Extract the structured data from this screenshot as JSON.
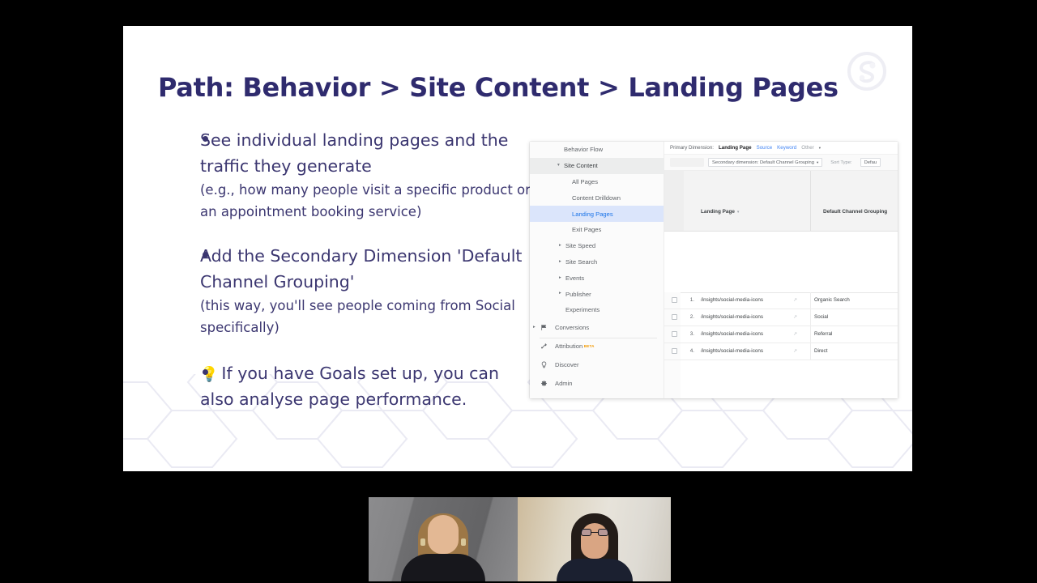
{
  "slide": {
    "title": "Path: Behavior > Site Content > Landing Pages",
    "watermark_icon": "circular-brand-logo",
    "accent_color": "#2f2b6e",
    "body_color": "#3b3670",
    "background": "#ffffff",
    "bullets": [
      {
        "dot": "•",
        "main": "See individual landing pages and the traffic they generate",
        "sub": "(e.g., how many people visit a specific product or an appointment booking service)"
      },
      {
        "dot": "•",
        "main": "Add the Secondary Dimension 'Default Channel Grouping'",
        "sub": "(this way, you'll see people coming from Social specifically)"
      },
      {
        "dot": "•",
        "emoji": "💡",
        "main": "If you have Goals set up, you can also analyse page performance.",
        "sub": ""
      }
    ]
  },
  "ga_screenshot": {
    "nav": [
      {
        "label": "Behavior Flow",
        "level": 2,
        "caret": "",
        "state": "normal"
      },
      {
        "label": "Site Content",
        "level": 2,
        "caret": "▾",
        "state": "header"
      },
      {
        "label": "All Pages",
        "level": 3,
        "caret": "",
        "state": "normal"
      },
      {
        "label": "Content Drilldown",
        "level": 3,
        "caret": "",
        "state": "normal"
      },
      {
        "label": "Landing Pages",
        "level": 3,
        "caret": "",
        "state": "active"
      },
      {
        "label": "Exit Pages",
        "level": 3,
        "caret": "",
        "state": "normal"
      },
      {
        "label": "Site Speed",
        "level": 2,
        "caret": "▸",
        "state": "normal"
      },
      {
        "label": "Site Search",
        "level": 2,
        "caret": "▸",
        "state": "normal"
      },
      {
        "label": "Events",
        "level": 2,
        "caret": "▸",
        "state": "normal"
      },
      {
        "label": "Publisher",
        "level": 2,
        "caret": "▸",
        "state": "normal"
      },
      {
        "label": "Experiments",
        "level": 2,
        "caret": "",
        "state": "normal"
      }
    ],
    "nav_bottom": [
      {
        "label": "Conversions",
        "icon": "flag-icon",
        "caret": "▸",
        "badge": ""
      },
      {
        "label": "Attribution",
        "icon": "attribution-icon",
        "caret": "",
        "badge": "BETA"
      },
      {
        "label": "Discover",
        "icon": "lightbulb-icon",
        "caret": "",
        "badge": ""
      },
      {
        "label": "Admin",
        "icon": "gear-icon",
        "caret": "",
        "badge": ""
      }
    ],
    "toolbar_primary": {
      "label": "Primary Dimension:",
      "selected": "Landing Page",
      "links": [
        "Source",
        "Keyword",
        "Other"
      ],
      "other_caret": "▾"
    },
    "toolbar_secondary": {
      "ghost_button": "",
      "secondary_dimension": "Secondary dimension: Default Channel Grouping",
      "secondary_caret": "▾",
      "sort_type_label": "Sort Type:",
      "sort_type_value": "Defau"
    },
    "table": {
      "columns": [
        "Landing Page",
        "Default Channel Grouping"
      ],
      "sort_caret": "▾",
      "rows": [
        {
          "index": "1.",
          "landing_page": "/insights/social-media-icons",
          "channel": "Organic Search"
        },
        {
          "index": "2.",
          "landing_page": "/insights/social-media-icons",
          "channel": "Social"
        },
        {
          "index": "3.",
          "landing_page": "/insights/social-media-icons",
          "channel": "Referral"
        },
        {
          "index": "4.",
          "landing_page": "/insights/social-media-icons",
          "channel": "Direct"
        }
      ],
      "row_link_icon": "external-link-icon",
      "row_checkbox": "row-checkbox"
    },
    "colors": {
      "active_row_bg": "#dbe5fb",
      "active_row_text": "#1a73e8",
      "beta_badge": "#f29900",
      "link": "#4285f4"
    }
  },
  "video_strip": {
    "tiles": [
      {
        "name": "participant-left",
        "caption": ""
      },
      {
        "name": "participant-right",
        "caption": ""
      }
    ]
  }
}
